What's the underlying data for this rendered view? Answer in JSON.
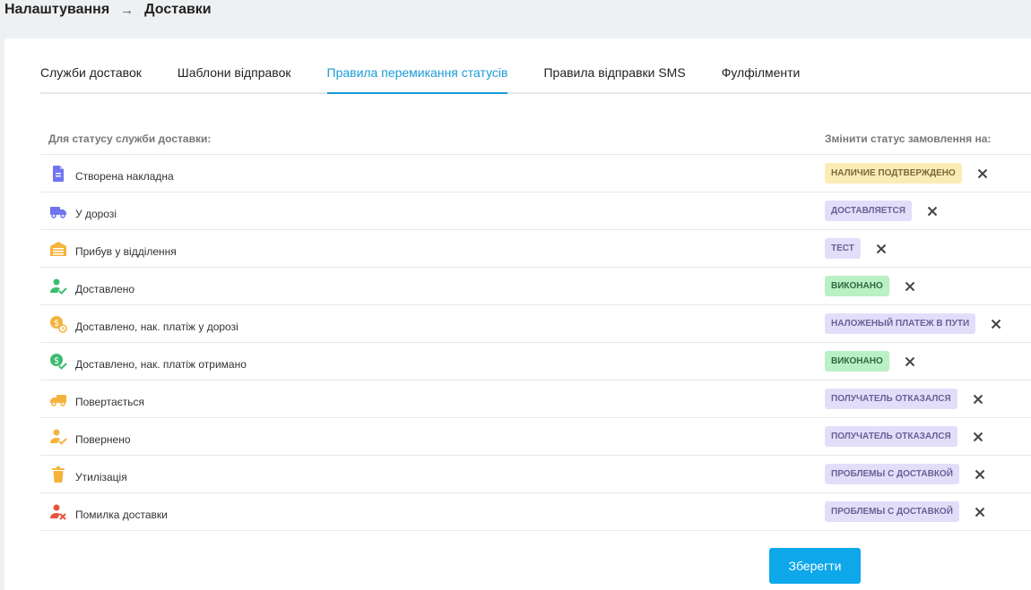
{
  "breadcrumb": {
    "parent": "Налаштування",
    "current": "Доставки"
  },
  "tabs": [
    {
      "label": "Служби доставок",
      "active": false
    },
    {
      "label": "Шаблони відправок",
      "active": false
    },
    {
      "label": "Правила перемикання статусів",
      "active": true
    },
    {
      "label": "Правила відправки SMS",
      "active": false
    },
    {
      "label": "Фулфілменти",
      "active": false
    }
  ],
  "table": {
    "col_from": "Для статусу служби доставки:",
    "col_to": "Змінити статус замовлення на:",
    "rows": [
      {
        "icon": "document-icon",
        "icon_color": "#6f74f0",
        "status": "Створена накладна",
        "badge": "НАЛИЧИЕ ПОДТВЕРЖДЕНО",
        "badge_color": "yellow"
      },
      {
        "icon": "truck-icon",
        "icon_color": "#6f74f0",
        "status": "У дорозі",
        "badge": "ДОСТАВЛЯЕТСЯ",
        "badge_color": "purple"
      },
      {
        "icon": "warehouse-icon",
        "icon_color": "#f5b33e",
        "status": "Прибув у відділення",
        "badge": "ТЕСТ",
        "badge_color": "purple"
      },
      {
        "icon": "user-check-icon",
        "icon_color": "#3dbb6f",
        "status": "Доставлено",
        "badge": "ВИКОНАНО",
        "badge_color": "green"
      },
      {
        "icon": "coin-clock-icon",
        "icon_color": "#f5b33e",
        "status": "Доставлено, нак. платіж у дорозі",
        "badge": "НАЛОЖЕНЫЙ ПЛАТЕЖ В ПУТИ",
        "badge_color": "purple"
      },
      {
        "icon": "coin-check-icon",
        "icon_color": "#3dbb6f",
        "status": "Доставлено, нак. платіж отримано",
        "badge": "ВИКОНАНО",
        "badge_color": "green"
      },
      {
        "icon": "truck-return-icon",
        "icon_color": "#f5b33e",
        "status": "Повертається",
        "badge": "ПОЛУЧАТЕЛЬ ОТКАЗАЛСЯ",
        "badge_color": "purple"
      },
      {
        "icon": "user-check-icon",
        "icon_color": "#f5b33e",
        "status": "Повернено",
        "badge": "ПОЛУЧАТЕЛЬ ОТКАЗАЛСЯ",
        "badge_color": "purple"
      },
      {
        "icon": "trash-icon",
        "icon_color": "#f5b33e",
        "status": "Утилізація",
        "badge": "ПРОБЛЕМЫ С ДОСТАВКОЙ",
        "badge_color": "purple"
      },
      {
        "icon": "user-error-icon",
        "icon_color": "#e8533f",
        "status": "Помилка доставки",
        "badge": "ПРОБЛЕМЫ С ДОСТАВКОЙ",
        "badge_color": "purple"
      }
    ]
  },
  "save_label": "Зберегти"
}
